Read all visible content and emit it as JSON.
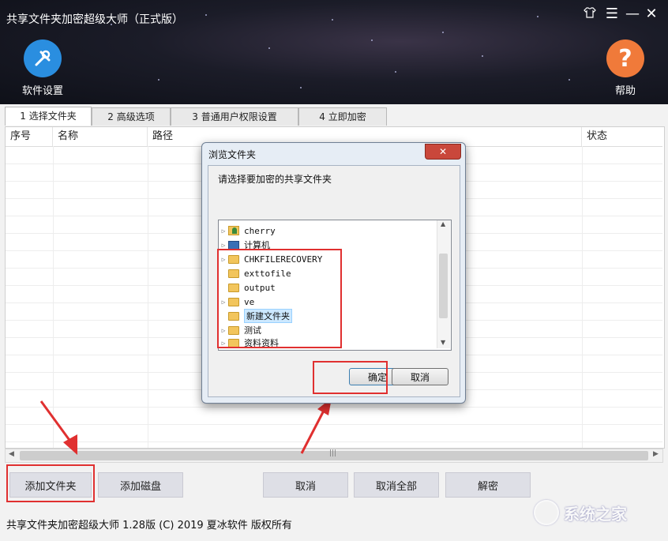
{
  "window": {
    "title": "共享文件夹加密超级大师（正式版）",
    "controls": {
      "skin": "skin-icon",
      "menu": "☰",
      "minimize": "—",
      "close": "✕"
    }
  },
  "header": {
    "settings_label": "软件设置",
    "help_label": "帮助",
    "colors": {
      "settings": "#2a8ee0",
      "help": "#f07a3a"
    }
  },
  "tabs": [
    "1 选择文件夹",
    "2 高级选项",
    "3 普通用户权限设置",
    "4 立即加密"
  ],
  "table": {
    "columns": [
      "序号",
      "名称",
      "路径",
      "状态"
    ]
  },
  "buttons": {
    "add_folder": "添加文件夹",
    "add_disk": "添加磁盘",
    "cancel": "取消",
    "cancel_all": "取消全部",
    "decrypt": "解密"
  },
  "status_bar": "共享文件夹加密超级大师 1.28版 (C) 2019 夏冰软件 版权所有",
  "dialog": {
    "title": "浏览文件夹",
    "close": "✕",
    "prompt": "请选择要加密的共享文件夹",
    "tree_items": [
      "cherry",
      "计算机",
      "CHKFILERECOVERY",
      "exttofile",
      "output",
      "ve",
      "新建文件夹",
      "测试",
      "资料资料"
    ],
    "ok": "确定",
    "cancel": "取消"
  },
  "watermark": "系统之家",
  "accent_colors": {
    "highlight": "#e03030",
    "selection": "#cce8ff"
  }
}
